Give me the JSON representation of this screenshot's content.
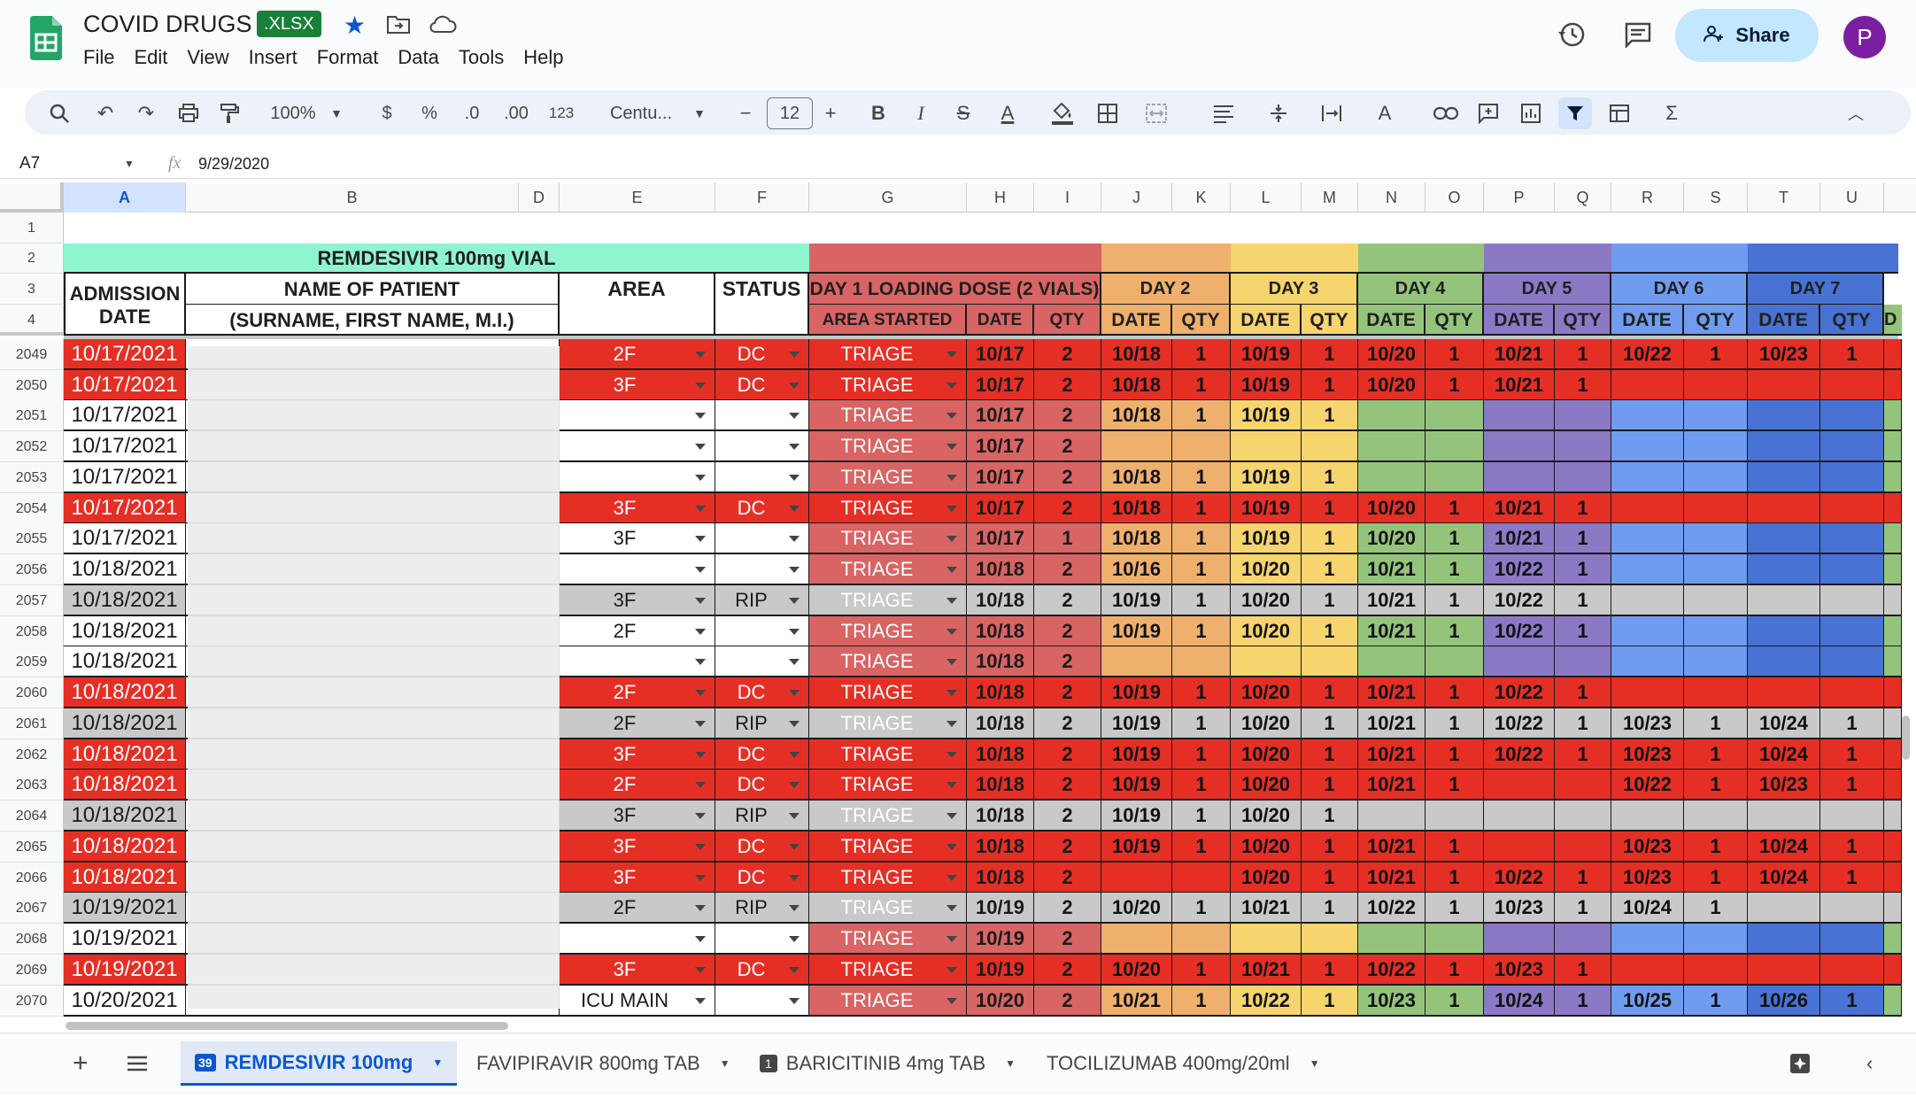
{
  "doc": {
    "title": "COVID DRUGS",
    "badge": ".XLSX"
  },
  "menu": [
    "File",
    "Edit",
    "View",
    "Insert",
    "Format",
    "Data",
    "Tools",
    "Help"
  ],
  "share_label": "Share",
  "avatar_initial": "P",
  "toolbar": {
    "zoom": "100%",
    "font": "Centu...",
    "font_size": "12",
    "currency": "$",
    "percent": "%",
    "dec_dec": ".0",
    "inc_dec": ".00",
    "num_fmt": "123"
  },
  "formula_bar": {
    "cell_ref": "A7",
    "fx": "fx",
    "value": "9/29/2020"
  },
  "col_headers": [
    "A",
    "B",
    "D",
    "E",
    "F",
    "G",
    "H",
    "I",
    "J",
    "K",
    "L",
    "M",
    "N",
    "O",
    "P",
    "Q",
    "R",
    "S",
    "T",
    "U"
  ],
  "sheet": {
    "banner": "REMDESIVIR 100mg VIAL",
    "h_admission": "ADMISSION DATE",
    "h_name_1": "NAME OF PATIENT",
    "h_name_2": "(SURNAME, FIRST NAME, M.I.)",
    "h_area": "AREA",
    "h_status": "STATUS",
    "h_day1": "DAY 1 LOADING DOSE (2 VIALS)",
    "h_area_started": "AREA STARTED",
    "h_date": "DATE",
    "h_qty": "QTY",
    "day_labels": [
      "DAY 2",
      "DAY 3",
      "DAY 4",
      "DAY 5",
      "DAY 6",
      "DAY 7"
    ],
    "v_cut": "D"
  },
  "row_numbers": [
    "1",
    "2",
    "3",
    "4"
  ],
  "rows": [
    {
      "n": "2049",
      "date": "10/17/2021",
      "area": "2F",
      "status": "DC",
      "started": "TRIAGE",
      "d1": "10/17",
      "q1": "2",
      "days": [
        [
          "10/18",
          "1"
        ],
        [
          "10/19",
          "1"
        ],
        [
          "10/20",
          "1"
        ],
        [
          "10/21",
          "1"
        ],
        [
          "10/22",
          "1"
        ],
        [
          "10/23",
          "1"
        ]
      ],
      "kind": "red"
    },
    {
      "n": "2050",
      "date": "10/17/2021",
      "area": "3F",
      "status": "DC",
      "started": "TRIAGE",
      "d1": "10/17",
      "q1": "2",
      "days": [
        [
          "10/18",
          "1"
        ],
        [
          "10/19",
          "1"
        ],
        [
          "10/20",
          "1"
        ],
        [
          "10/21",
          "1"
        ],
        [
          "",
          ""
        ],
        [
          "",
          ""
        ]
      ],
      "kind": "red"
    },
    {
      "n": "2051",
      "date": "10/17/2021",
      "area": "",
      "status": "",
      "started": "TRIAGE",
      "d1": "10/17",
      "q1": "2",
      "days": [
        [
          "10/18",
          "1"
        ],
        [
          "10/19",
          "1"
        ],
        [
          "",
          ""
        ],
        [
          "",
          ""
        ],
        [
          "",
          ""
        ],
        [
          "",
          ""
        ]
      ],
      "kind": "white"
    },
    {
      "n": "2052",
      "date": "10/17/2021",
      "area": "",
      "status": "",
      "started": "TRIAGE",
      "d1": "10/17",
      "q1": "2",
      "days": [
        [
          "",
          ""
        ],
        [
          "",
          ""
        ],
        [
          "",
          ""
        ],
        [
          "",
          ""
        ],
        [
          "",
          ""
        ],
        [
          "",
          ""
        ]
      ],
      "kind": "white"
    },
    {
      "n": "2053",
      "date": "10/17/2021",
      "area": "",
      "status": "",
      "started": "TRIAGE",
      "d1": "10/17",
      "q1": "2",
      "days": [
        [
          "10/18",
          "1"
        ],
        [
          "10/19",
          "1"
        ],
        [
          "",
          ""
        ],
        [
          "",
          ""
        ],
        [
          "",
          ""
        ],
        [
          "",
          ""
        ]
      ],
      "kind": "white"
    },
    {
      "n": "2054",
      "date": "10/17/2021",
      "area": "3F",
      "status": "DC",
      "started": "TRIAGE",
      "d1": "10/17",
      "q1": "2",
      "days": [
        [
          "10/18",
          "1"
        ],
        [
          "10/19",
          "1"
        ],
        [
          "10/20",
          "1"
        ],
        [
          "10/21",
          "1"
        ],
        [
          "",
          ""
        ],
        [
          "",
          ""
        ]
      ],
      "kind": "red"
    },
    {
      "n": "2055",
      "date": "10/17/2021",
      "area": "3F",
      "status": "",
      "started": "TRIAGE",
      "d1": "10/17",
      "q1": "1",
      "days": [
        [
          "10/18",
          "1"
        ],
        [
          "10/19",
          "1"
        ],
        [
          "10/20",
          "1"
        ],
        [
          "10/21",
          "1"
        ],
        [
          "",
          ""
        ],
        [
          "",
          ""
        ]
      ],
      "kind": "white"
    },
    {
      "n": "2056",
      "date": "10/18/2021",
      "area": "",
      "status": "",
      "started": "TRIAGE",
      "d1": "10/18",
      "q1": "2",
      "days": [
        [
          "10/16",
          "1"
        ],
        [
          "10/20",
          "1"
        ],
        [
          "10/21",
          "1"
        ],
        [
          "10/22",
          "1"
        ],
        [
          "",
          ""
        ],
        [
          "",
          ""
        ]
      ],
      "kind": "white"
    },
    {
      "n": "2057",
      "date": "10/18/2021",
      "area": "3F",
      "status": "RIP",
      "started": "TRIAGE",
      "d1": "10/18",
      "q1": "2",
      "days": [
        [
          "10/19",
          "1"
        ],
        [
          "10/20",
          "1"
        ],
        [
          "10/21",
          "1"
        ],
        [
          "10/22",
          "1"
        ],
        [
          "",
          ""
        ],
        [
          "",
          ""
        ]
      ],
      "kind": "gray"
    },
    {
      "n": "2058",
      "date": "10/18/2021",
      "area": "2F",
      "status": "",
      "started": "TRIAGE",
      "d1": "10/18",
      "q1": "2",
      "days": [
        [
          "10/19",
          "1"
        ],
        [
          "10/20",
          "1"
        ],
        [
          "10/21",
          "1"
        ],
        [
          "10/22",
          "1"
        ],
        [
          "",
          ""
        ],
        [
          "",
          ""
        ]
      ],
      "kind": "white"
    },
    {
      "n": "2059",
      "date": "10/18/2021",
      "area": "",
      "status": "",
      "started": "TRIAGE",
      "d1": "10/18",
      "q1": "2",
      "days": [
        [
          "",
          ""
        ],
        [
          "",
          ""
        ],
        [
          "",
          ""
        ],
        [
          "",
          ""
        ],
        [
          "",
          ""
        ],
        [
          "",
          ""
        ]
      ],
      "kind": "white"
    },
    {
      "n": "2060",
      "date": "10/18/2021",
      "area": "2F",
      "status": "DC",
      "started": "TRIAGE",
      "d1": "10/18",
      "q1": "2",
      "days": [
        [
          "10/19",
          "1"
        ],
        [
          "10/20",
          "1"
        ],
        [
          "10/21",
          "1"
        ],
        [
          "10/22",
          "1"
        ],
        [
          "",
          ""
        ],
        [
          "",
          ""
        ]
      ],
      "kind": "red"
    },
    {
      "n": "2061",
      "date": "10/18/2021",
      "area": "2F",
      "status": "RIP",
      "started": "TRIAGE",
      "d1": "10/18",
      "q1": "2",
      "days": [
        [
          "10/19",
          "1"
        ],
        [
          "10/20",
          "1"
        ],
        [
          "10/21",
          "1"
        ],
        [
          "10/22",
          "1"
        ],
        [
          "10/23",
          "1"
        ],
        [
          "10/24",
          "1"
        ]
      ],
      "kind": "gray"
    },
    {
      "n": "2062",
      "date": "10/18/2021",
      "area": "3F",
      "status": "DC",
      "started": "TRIAGE",
      "d1": "10/18",
      "q1": "2",
      "days": [
        [
          "10/19",
          "1"
        ],
        [
          "10/20",
          "1"
        ],
        [
          "10/21",
          "1"
        ],
        [
          "10/22",
          "1"
        ],
        [
          "10/23",
          "1"
        ],
        [
          "10/24",
          "1"
        ]
      ],
      "kind": "red"
    },
    {
      "n": "2063",
      "date": "10/18/2021",
      "area": "2F",
      "status": "DC",
      "started": "TRIAGE",
      "d1": "10/18",
      "q1": "2",
      "days": [
        [
          "10/19",
          "1"
        ],
        [
          "10/20",
          "1"
        ],
        [
          "10/21",
          "1"
        ],
        [
          "",
          ""
        ],
        [
          "10/22",
          "1"
        ],
        [
          "10/23",
          "1"
        ]
      ],
      "kind": "red"
    },
    {
      "n": "2064",
      "date": "10/18/2021",
      "area": "3F",
      "status": "RIP",
      "started": "TRIAGE",
      "d1": "10/18",
      "q1": "2",
      "days": [
        [
          "10/19",
          "1"
        ],
        [
          "10/20",
          "1"
        ],
        [
          "",
          ""
        ],
        [
          "",
          ""
        ],
        [
          "",
          ""
        ],
        [
          "",
          ""
        ]
      ],
      "kind": "gray"
    },
    {
      "n": "2065",
      "date": "10/18/2021",
      "area": "3F",
      "status": "DC",
      "started": "TRIAGE",
      "d1": "10/18",
      "q1": "2",
      "days": [
        [
          "10/19",
          "1"
        ],
        [
          "10/20",
          "1"
        ],
        [
          "10/21",
          "1"
        ],
        [
          "",
          ""
        ],
        [
          "10/23",
          "1"
        ],
        [
          "10/24",
          "1"
        ]
      ],
      "kind": "red"
    },
    {
      "n": "2066",
      "date": "10/18/2021",
      "area": "3F",
      "status": "DC",
      "started": "TRIAGE",
      "d1": "10/18",
      "q1": "2",
      "days": [
        [
          "",
          ""
        ],
        [
          "10/20",
          "1"
        ],
        [
          "10/21",
          "1"
        ],
        [
          "10/22",
          "1"
        ],
        [
          "10/23",
          "1"
        ],
        [
          "10/24",
          "1"
        ]
      ],
      "kind": "red"
    },
    {
      "n": "2067",
      "date": "10/19/2021",
      "area": "2F",
      "status": "RIP",
      "started": "TRIAGE",
      "d1": "10/19",
      "q1": "2",
      "days": [
        [
          "10/20",
          "1"
        ],
        [
          "10/21",
          "1"
        ],
        [
          "10/22",
          "1"
        ],
        [
          "10/23",
          "1"
        ],
        [
          "10/24",
          "1"
        ],
        [
          "",
          ""
        ]
      ],
      "kind": "gray"
    },
    {
      "n": "2068",
      "date": "10/19/2021",
      "area": "",
      "status": "",
      "started": "TRIAGE",
      "d1": "10/19",
      "q1": "2",
      "days": [
        [
          "",
          ""
        ],
        [
          "",
          ""
        ],
        [
          "",
          ""
        ],
        [
          "",
          ""
        ],
        [
          "",
          ""
        ],
        [
          "",
          ""
        ]
      ],
      "kind": "white"
    },
    {
      "n": "2069",
      "date": "10/19/2021",
      "area": "3F",
      "status": "DC",
      "started": "TRIAGE",
      "d1": "10/19",
      "q1": "2",
      "days": [
        [
          "10/20",
          "1"
        ],
        [
          "10/21",
          "1"
        ],
        [
          "10/22",
          "1"
        ],
        [
          "10/23",
          "1"
        ],
        [
          "",
          ""
        ],
        [
          "",
          ""
        ]
      ],
      "kind": "red"
    },
    {
      "n": "2070",
      "date": "10/20/2021",
      "area": "ICU MAIN",
      "status": "",
      "started": "TRIAGE",
      "d1": "10/20",
      "q1": "2",
      "days": [
        [
          "10/21",
          "1"
        ],
        [
          "10/22",
          "1"
        ],
        [
          "10/23",
          "1"
        ],
        [
          "10/24",
          "1"
        ],
        [
          "10/25",
          "1"
        ],
        [
          "10/26",
          "1"
        ]
      ],
      "kind": "white"
    }
  ],
  "sheet_tabs": [
    {
      "label": "REMDESIVIR 100mg",
      "badge": "39",
      "active": true
    },
    {
      "label": "FAVIPIRAVIR 800mg TAB",
      "badge": "",
      "active": false
    },
    {
      "label": "BARICITINIB 4mg TAB",
      "badge": "1",
      "active": false
    },
    {
      "label": "TOCILIZUMAB 400mg/20ml",
      "badge": "",
      "active": false
    }
  ],
  "colors": {
    "banner": "#8ff5cf",
    "red": "#e52f25",
    "gray": "#c9c9c9",
    "day1": "#d86464",
    "day2": "#eeb06c",
    "day3": "#f6d46e",
    "day4": "#94c47c",
    "day5": "#8b79c6",
    "day6": "#6f9cef",
    "day7": "#4872d3",
    "accent": "#0b57d0"
  },
  "icons": [
    "sheets-logo-icon",
    "star-icon",
    "move-folder-icon",
    "cloud-icon",
    "history-icon",
    "comment-icon",
    "share-people-icon"
  ]
}
